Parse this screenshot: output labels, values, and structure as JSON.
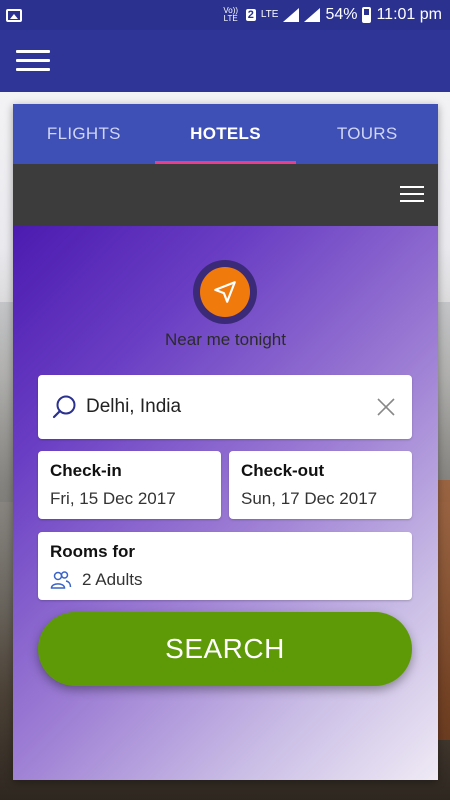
{
  "status_bar": {
    "lte1": "Vo)) LTE",
    "sim": "2",
    "lte2": "LTE",
    "battery_pct": "54%",
    "time": "11:01 pm"
  },
  "tabs": [
    {
      "label": "FLIGHTS",
      "active": false
    },
    {
      "label": "HOTELS",
      "active": true
    },
    {
      "label": "TOURS",
      "active": false
    }
  ],
  "location": {
    "near_label": "Near me tonight"
  },
  "search": {
    "value": "Delhi, India"
  },
  "checkin": {
    "title": "Check-in",
    "value": "Fri, 15 Dec 2017"
  },
  "checkout": {
    "title": "Check-out",
    "value": "Sun, 17 Dec 2017"
  },
  "rooms": {
    "title": "Rooms for",
    "value": "2 Adults"
  },
  "search_button": {
    "label": "SEARCH"
  },
  "colors": {
    "status_bar": "#2a318f",
    "appbar": "#2f3596",
    "tabs_bg": "#3e4fb6",
    "tab_indicator": "#e83e8c",
    "locator_orange": "#f17a0d",
    "search_button": "#5e9a08"
  },
  "icons": {
    "status_left": "image-icon",
    "menu": "hamburger-icon",
    "locator": "navigation-arrow-icon",
    "search": "search-icon",
    "clear": "close-icon",
    "rooms": "people-icon"
  }
}
